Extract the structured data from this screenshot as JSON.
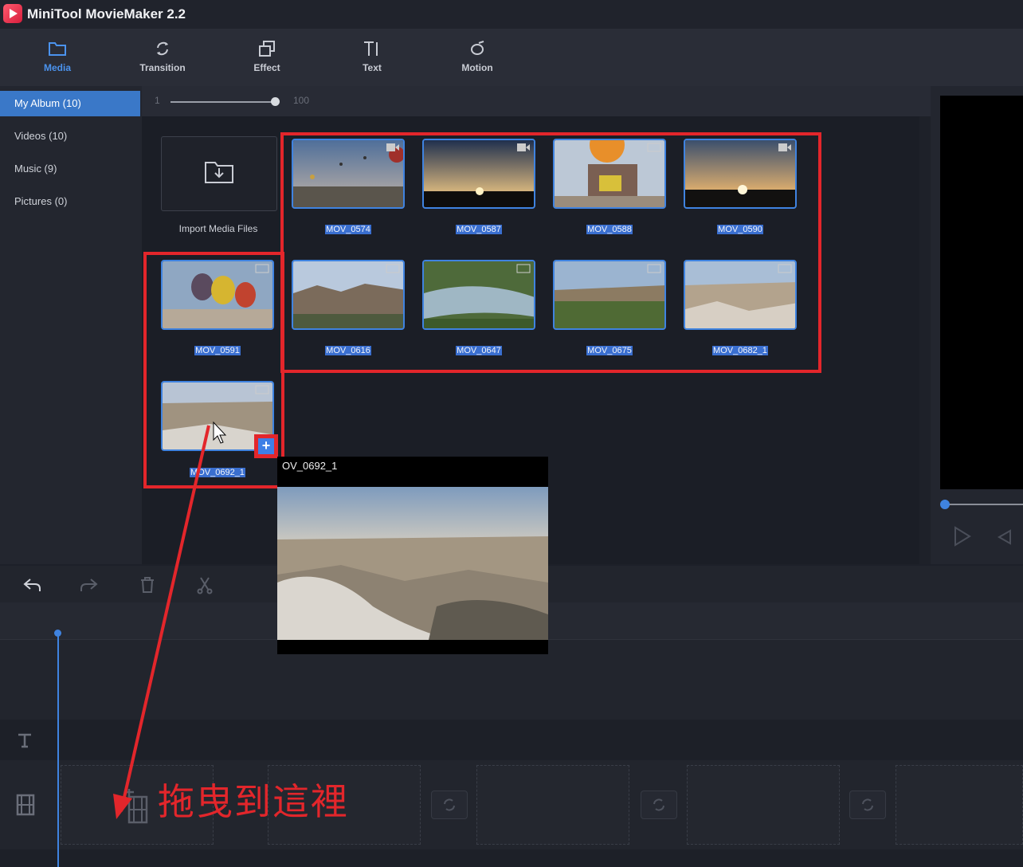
{
  "app": {
    "title": "MiniTool MovieMaker 2.2"
  },
  "toolbar": {
    "tabs": [
      {
        "label": "Media",
        "icon": "folder-icon",
        "active": true
      },
      {
        "label": "Transition",
        "icon": "transition-icon"
      },
      {
        "label": "Effect",
        "icon": "effect-icon"
      },
      {
        "label": "Text",
        "icon": "text-icon"
      },
      {
        "label": "Motion",
        "icon": "motion-icon"
      }
    ]
  },
  "sidebar": {
    "items": [
      {
        "label": "My Album  (10)",
        "active": true
      },
      {
        "label": "Videos  (10)"
      },
      {
        "label": "Music  (9)"
      },
      {
        "label": "Pictures  (0)"
      }
    ]
  },
  "zoom": {
    "min": "1",
    "max": "100"
  },
  "media": {
    "import_label": "Import Media Files",
    "files": [
      {
        "name": "MOV_0574",
        "type": "video"
      },
      {
        "name": "MOV_0587",
        "type": "video"
      },
      {
        "name": "MOV_0588",
        "type": "video"
      },
      {
        "name": "MOV_0590",
        "type": "video"
      },
      {
        "name": "MOV_0591",
        "type": "video"
      },
      {
        "name": "MOV_0616",
        "type": "video"
      },
      {
        "name": "MOV_0647",
        "type": "video"
      },
      {
        "name": "MOV_0675",
        "type": "video"
      },
      {
        "name": "MOV_0682_1",
        "type": "video"
      },
      {
        "name": "MOV_0692_1",
        "type": "video"
      }
    ]
  },
  "preview_popup": {
    "title": "OV_0692_1"
  },
  "annotation": {
    "drop_hint": "拖曳到這裡"
  },
  "colors": {
    "accent": "#3f83e0",
    "highlight": "#e3262b",
    "selection": "#3a6fd0"
  }
}
